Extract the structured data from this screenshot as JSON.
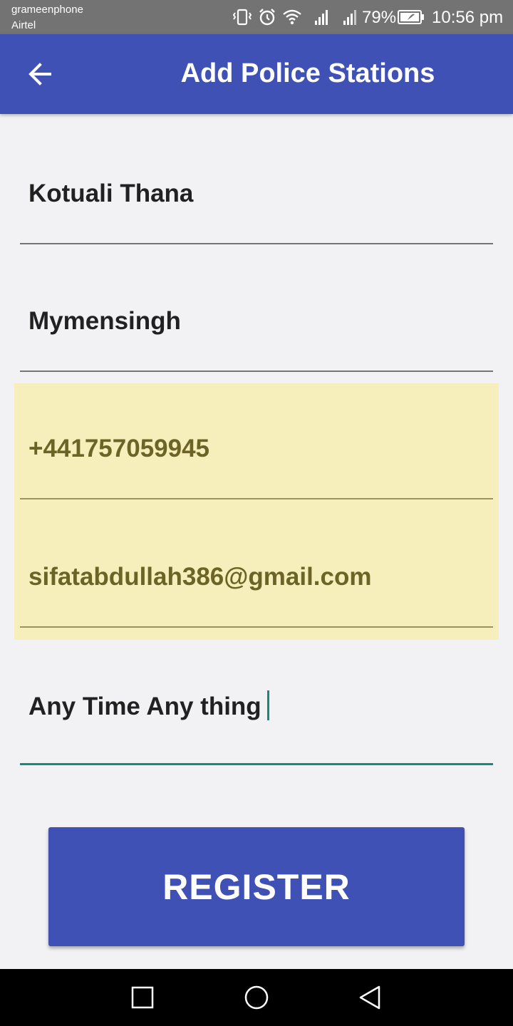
{
  "status_bar": {
    "carrier_primary": "grameenphone",
    "carrier_secondary": "Airtel",
    "battery_percent": "79%",
    "time": "10:56 pm",
    "icons": [
      "vibrate-icon",
      "alarm-icon",
      "wifi-icon",
      "signal-icon",
      "signal-icon",
      "battery-icon"
    ]
  },
  "app_bar": {
    "title": "Add Police Stations",
    "back_icon": "arrow-left-icon",
    "color": "#3f51b5"
  },
  "form": {
    "station_name": "Kotuali Thana",
    "district": "Mymensingh",
    "phone": "+441757059945",
    "email": "sifatabdullah386@gmail.com",
    "note": "Any Time Any thing",
    "autofill_highlight_color": "#f6efbb",
    "focus_color": "#178a7c"
  },
  "register_button": {
    "label": "REGISTER"
  },
  "nav_bar": {
    "items": [
      "recents-square-icon",
      "home-circle-icon",
      "back-triangle-icon"
    ]
  }
}
